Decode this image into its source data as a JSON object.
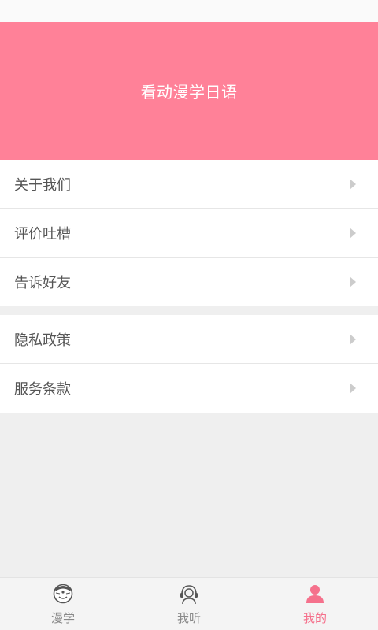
{
  "header": {
    "title": "看动漫学日语"
  },
  "menu_groups": [
    {
      "items": [
        {
          "label": "关于我们"
        },
        {
          "label": "评价吐槽"
        },
        {
          "label": "告诉好友"
        }
      ]
    },
    {
      "items": [
        {
          "label": "隐私政策"
        },
        {
          "label": "服务条款"
        }
      ]
    }
  ],
  "tab_bar": {
    "tabs": [
      {
        "label": "漫学",
        "icon": "doraemon-icon"
      },
      {
        "label": "我听",
        "icon": "headphones-person-icon"
      },
      {
        "label": "我的",
        "icon": "user-icon",
        "active": true
      }
    ],
    "active_color": "#f5718c",
    "inactive_color": "#888888"
  },
  "colors": {
    "header_bg": "#ff8198",
    "page_bg": "#efefef"
  }
}
